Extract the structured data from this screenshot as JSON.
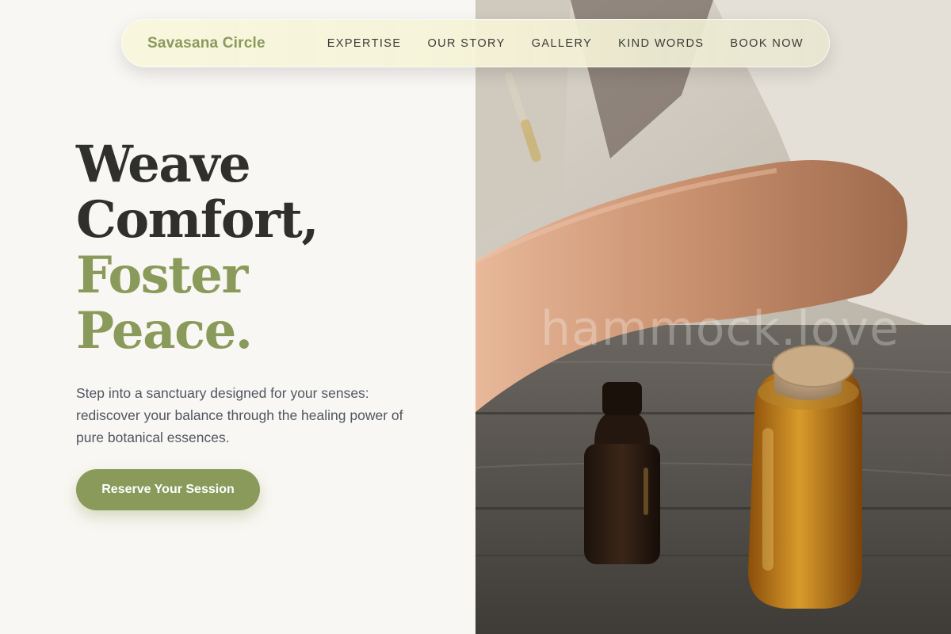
{
  "nav": {
    "brand": "Savasana Circle",
    "links": [
      "EXPERTISE",
      "OUR STORY",
      "GALLERY",
      "KIND WORDS",
      "BOOK NOW"
    ]
  },
  "hero": {
    "title_lines": [
      "Weave",
      "Comfort,",
      "Foster",
      "Peace."
    ],
    "description": "Step into a sanctuary designed for your senses: rediscover your balance through the healing power of pure botanical essences.",
    "cta_label": "Reserve Your Session"
  },
  "photo": {
    "watermark": "hammock.love"
  },
  "colors": {
    "accent": "#8a9a5b",
    "page_background": "#f9f7f3",
    "heading_dark": "#2f2f2c",
    "body_text": "#4f5660"
  }
}
